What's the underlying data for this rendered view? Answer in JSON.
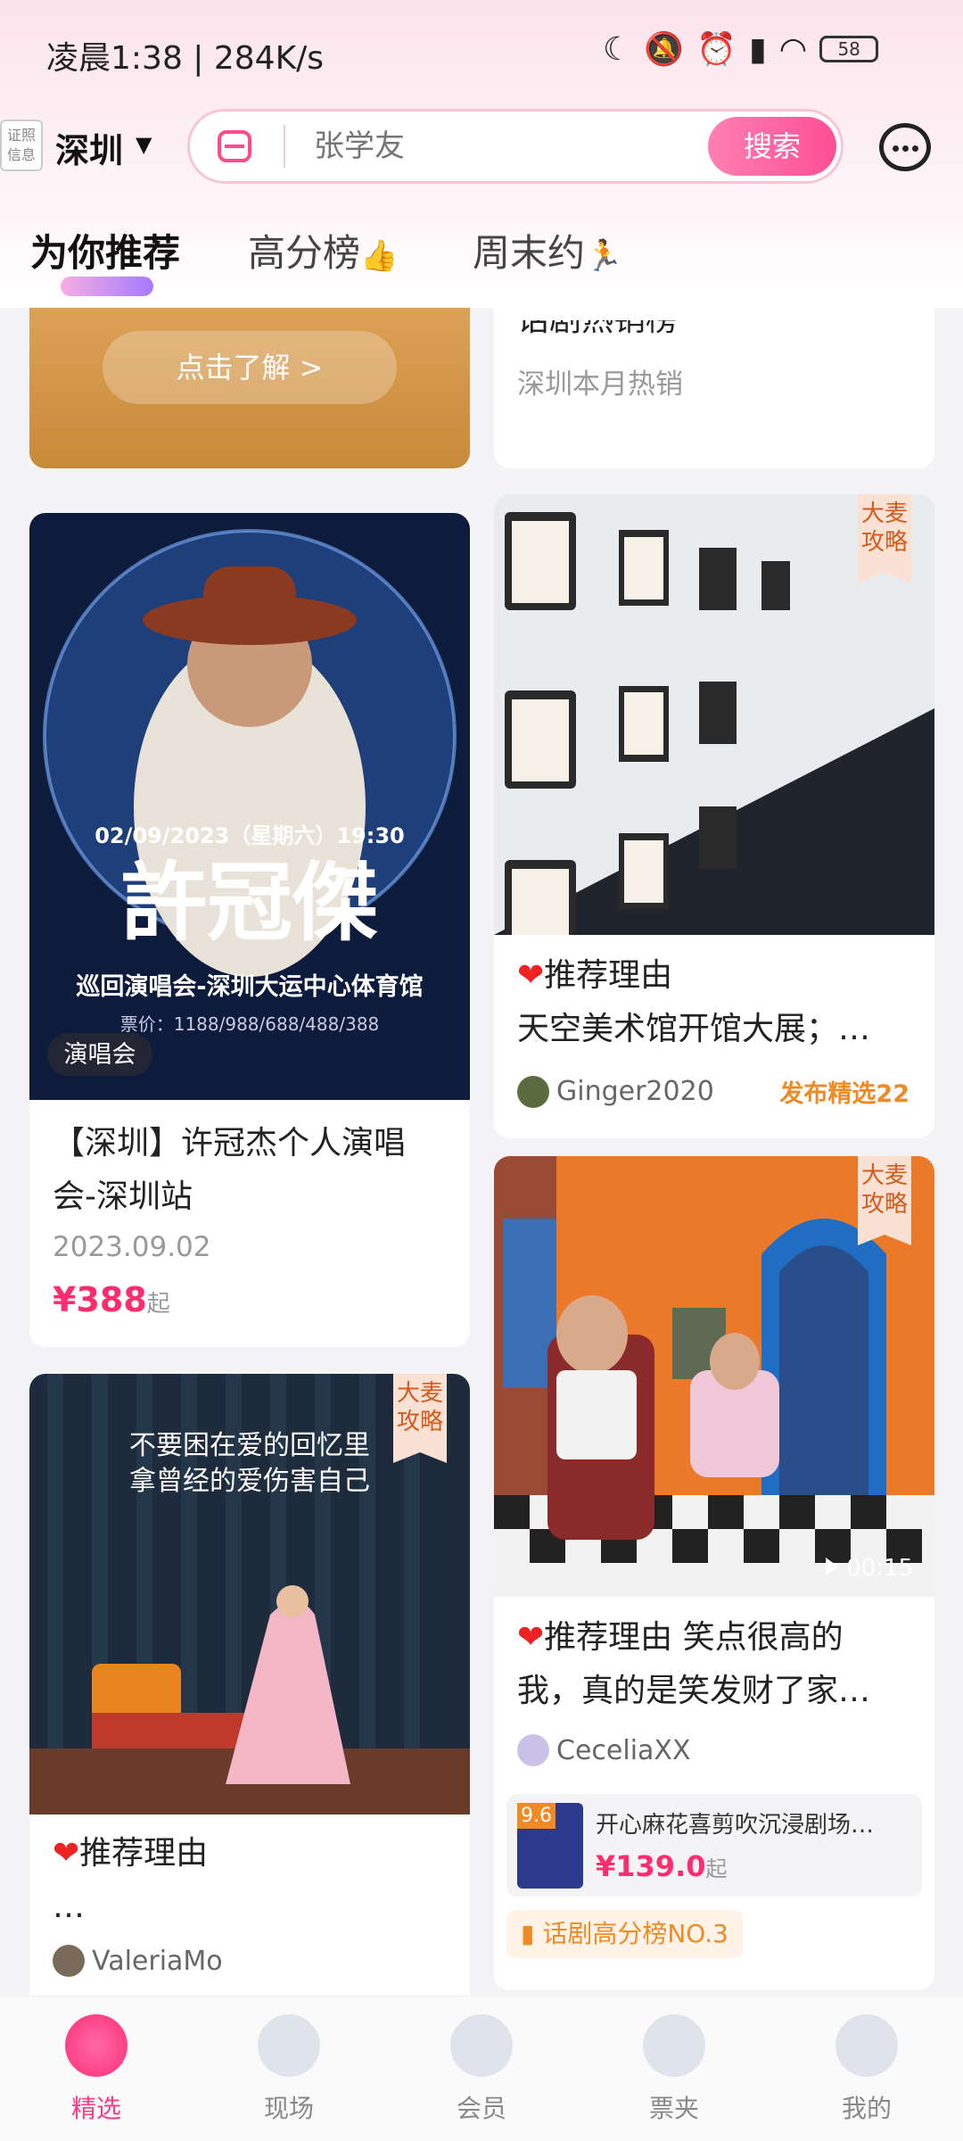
{
  "status": {
    "time": "凌晨1:38 | 284K/s",
    "battery": "58",
    "icons": [
      "moon-icon",
      "mute-icon",
      "alarm-icon",
      "signal-icon",
      "wifi-icon"
    ]
  },
  "header": {
    "cert_label": "证照信息",
    "city": "深圳",
    "search_placeholder": "张学友",
    "search_button": "搜索"
  },
  "tabs": [
    {
      "label": "为你推荐"
    },
    {
      "label": "高分榜"
    },
    {
      "label": "周末约"
    }
  ],
  "promo": {
    "button": "点击了解 >"
  },
  "hot": {
    "title": "话剧热销榜",
    "sub": "深圳本月热销"
  },
  "card1": {
    "tag": "演唱会",
    "poster_date": "02/09/2023（星期六）19:30",
    "poster_name": "許冠傑",
    "poster_venue": "巡回演唱会-深圳大运中心体育馆",
    "poster_price": "票价：1188/988/688/488/388",
    "title1": "【深圳】许冠杰个人演唱",
    "title2": "会-深圳站",
    "date": "2023.09.02",
    "price": "¥388",
    "price_suffix": "起"
  },
  "card2": {
    "corner": "大麦攻略",
    "title1": "推荐理由",
    "title2": "天空美术馆开馆大展；…",
    "user": "Ginger2020",
    "badge": "发布精选22"
  },
  "card3": {
    "corner": "大麦攻略",
    "duration": "00:15",
    "title1": "推荐理由 笑点很高的",
    "title2": "我，真的是笑发财了家…",
    "user": "CeceliaXX",
    "show_score": "9.6",
    "show_name": "开心麻花喜剪吹沉浸剧场…",
    "show_price": "¥139.0",
    "show_price_suffix": "起",
    "rank": "话剧高分榜NO.3"
  },
  "card4": {
    "corner": "大麦攻略",
    "poster_line1": "不要困在爱的回忆里",
    "poster_line2": "拿曾经的爱伤害自己",
    "title1": "推荐理由",
    "title2": "…",
    "user": "ValeriaMo"
  },
  "nav": [
    {
      "label": "精选"
    },
    {
      "label": "现场"
    },
    {
      "label": "会员"
    },
    {
      "label": "票夹"
    },
    {
      "label": "我的"
    }
  ],
  "colors": {
    "accent": "#ff3c83",
    "price": "#ff2d6f",
    "badge": "#f08a24"
  }
}
